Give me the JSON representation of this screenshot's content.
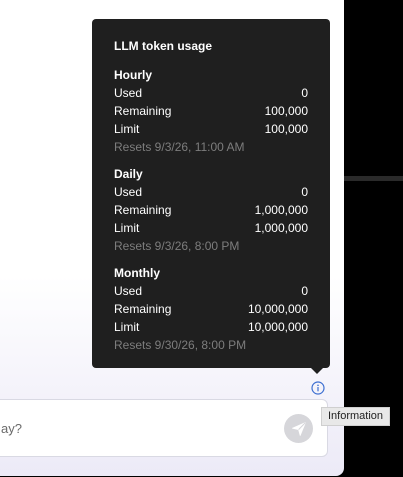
{
  "popover": {
    "title": "LLM token usage",
    "sections": [
      {
        "title": "Hourly",
        "rows": [
          {
            "label": "Used",
            "value": "0"
          },
          {
            "label": "Remaining",
            "value": "100,000"
          },
          {
            "label": "Limit",
            "value": "100,000"
          }
        ],
        "resets": "Resets 9/3/26, 11:00 AM"
      },
      {
        "title": "Daily",
        "rows": [
          {
            "label": "Used",
            "value": "0"
          },
          {
            "label": "Remaining",
            "value": "1,000,000"
          },
          {
            "label": "Limit",
            "value": "1,000,000"
          }
        ],
        "resets": "Resets 9/3/26, 8:00 PM"
      },
      {
        "title": "Monthly",
        "rows": [
          {
            "label": "Used",
            "value": "0"
          },
          {
            "label": "Remaining",
            "value": "10,000,000"
          },
          {
            "label": "Limit",
            "value": "10,000,000"
          }
        ],
        "resets": "Resets 9/30/26, 8:00 PM"
      }
    ]
  },
  "input": {
    "visible_text": "ay?"
  },
  "info_button": {
    "icon": "info-icon"
  },
  "send_button": {
    "icon": "send-icon"
  },
  "tooltip": {
    "text": "Information"
  },
  "colors": {
    "popover_bg": "#1f1f1f",
    "accent": "#3d6fd1",
    "muted_text": "#7d7d7d"
  }
}
